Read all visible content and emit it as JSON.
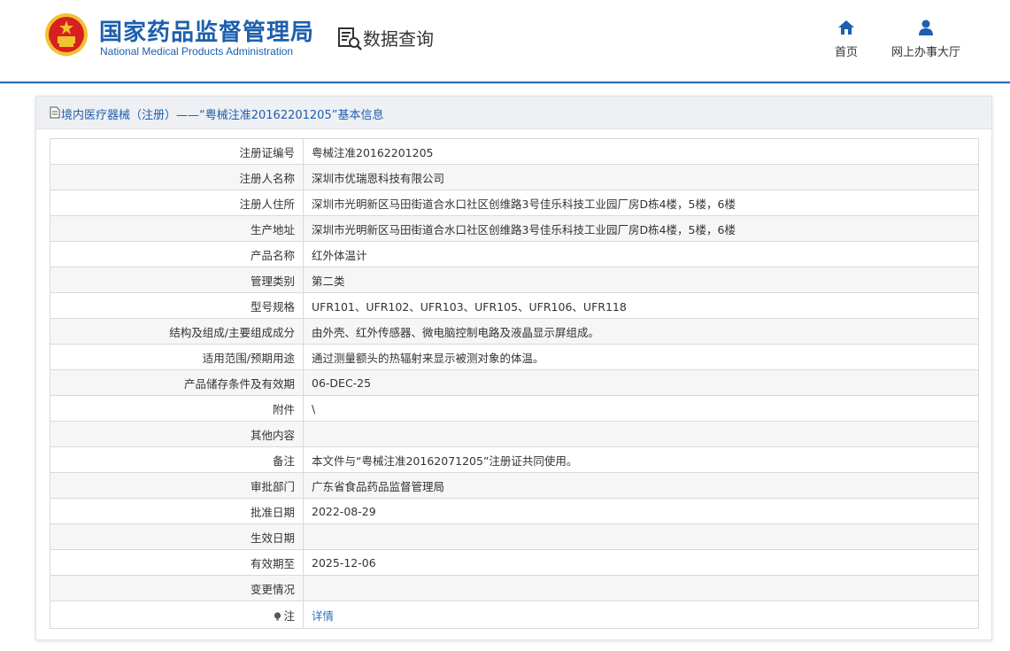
{
  "header": {
    "title_cn": "国家药品监督管理局",
    "title_en": "National Medical Products Administration",
    "query_title": "数据查询",
    "nav": [
      {
        "label": "首页",
        "icon": "home-icon"
      },
      {
        "label": "网上办事大厅",
        "icon": "user-icon"
      }
    ]
  },
  "panel": {
    "title": "境内医疗器械（注册）——“粤械注准20162201205”基本信息",
    "rows": [
      {
        "label": "注册证编号",
        "value": "粤械注准20162201205"
      },
      {
        "label": "注册人名称",
        "value": "深圳市优瑞恩科技有限公司"
      },
      {
        "label": "注册人住所",
        "value": "深圳市光明新区马田街道合水口社区创维路3号佳乐科技工业园厂房D栋4楼，5楼，6楼"
      },
      {
        "label": "生产地址",
        "value": "深圳市光明新区马田街道合水口社区创维路3号佳乐科技工业园厂房D栋4楼，5楼，6楼"
      },
      {
        "label": "产品名称",
        "value": "红外体温计"
      },
      {
        "label": "管理类别",
        "value": "第二类"
      },
      {
        "label": "型号规格",
        "value": "UFR101、UFR102、UFR103、UFR105、UFR106、UFR118"
      },
      {
        "label": "结构及组成/主要组成成分",
        "value": "由外壳、红外传感器、微电脑控制电路及液晶显示屏组成。"
      },
      {
        "label": "适用范围/预期用途",
        "value": "通过测量额头的热辐射来显示被测对象的体温。"
      },
      {
        "label": "产品储存条件及有效期",
        "value": "06-DEC-25"
      },
      {
        "label": "附件",
        "value": "\\"
      },
      {
        "label": "其他内容",
        "value": ""
      },
      {
        "label": "备注",
        "value": "本文件与“粤械注准20162071205”注册证共同使用。"
      },
      {
        "label": "审批部门",
        "value": "广东省食品药品监督管理局"
      },
      {
        "label": "批准日期",
        "value": "2022-08-29"
      },
      {
        "label": "生效日期",
        "value": ""
      },
      {
        "label": "有效期至",
        "value": "2025-12-06"
      },
      {
        "label": "变更情况",
        "value": ""
      }
    ],
    "note_label": "注",
    "note_link": "详情"
  },
  "colors": {
    "brand_blue": "#1d5fae",
    "link_blue": "#2a73c2",
    "emblem_red": "#d7201f",
    "emblem_gold": "#f2c230"
  }
}
